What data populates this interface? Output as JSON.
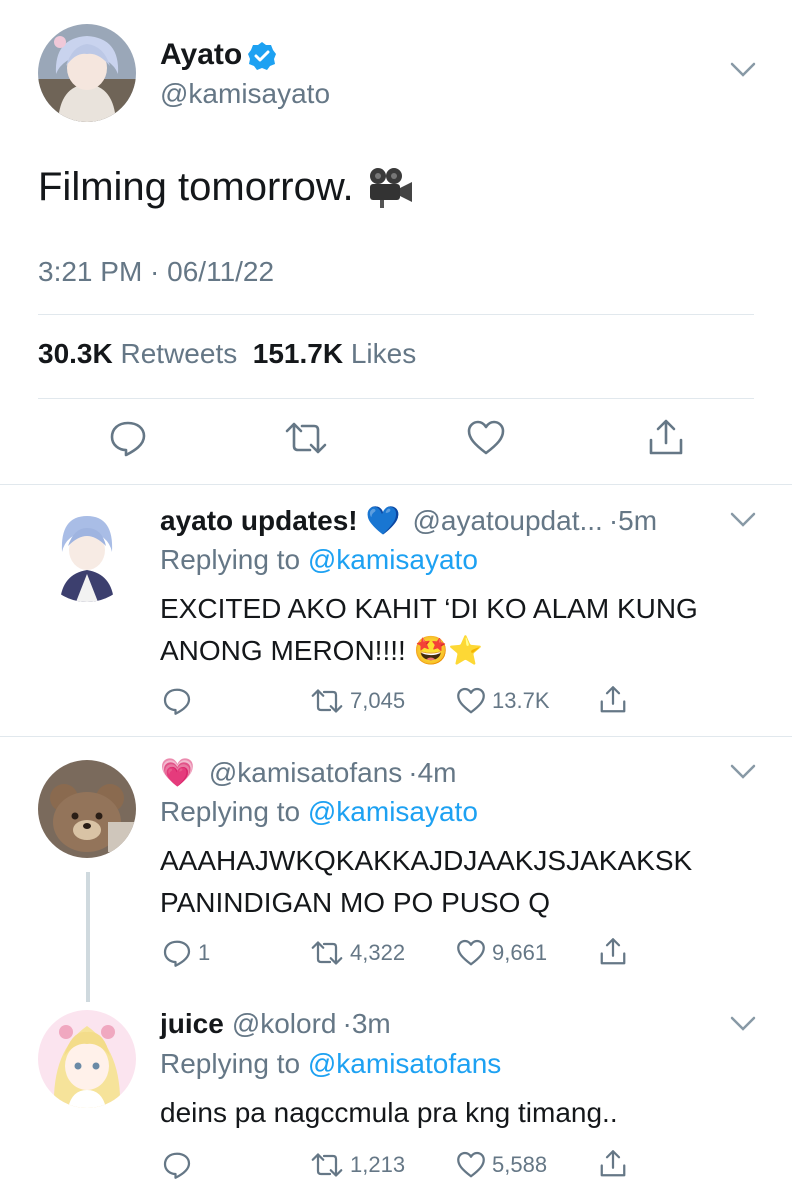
{
  "main_tweet": {
    "name": "Ayato",
    "handle": "@kamisayato",
    "text": "Filming tomorrow.",
    "emoji": "🎥",
    "timestamp": "3:21 PM · 06/11/22",
    "retweets_count": "30.3K",
    "retweets_label": "Retweets",
    "likes_count": "151.7K",
    "likes_label": "Likes"
  },
  "replies": [
    {
      "name": "ayato updates!",
      "name_emoji": "💙",
      "handle": "@ayatoupdat...",
      "time": "·5m",
      "replying_label": "Replying to",
      "replying_to": "@kamisayato",
      "text_line1": "EXCITED AKO KAHIT ‘DI KO ALAM KUNG",
      "text_line2": "ANONG MERON!!!! 🤩⭐",
      "replies": "",
      "retweets": "7,045",
      "likes": "13.7K"
    },
    {
      "name_emoji": "💗",
      "handle": "@kamisatofans",
      "time": "·4m",
      "replying_label": "Replying to",
      "replying_to": "@kamisayato",
      "text_line1": "AAAHAJWKQKAKKAJDJAAKJSJAKAKSK",
      "text_line2": "PANINDIGAN MO PO PUSO Q",
      "replies": "1",
      "retweets": "4,322",
      "likes": "9,661"
    },
    {
      "name": "juice",
      "handle": "@kolord",
      "time": "·3m",
      "replying_label": "Replying to",
      "replying_to": "@kamisatofans",
      "text_line1": "deins pa nagccmula pra kng timang..",
      "replies": "",
      "retweets": "1,213",
      "likes": "5,588"
    }
  ],
  "colors": {
    "text": "#14171a",
    "secondary": "#657786",
    "link": "#1da1f2",
    "divider": "#e1e8ed"
  }
}
